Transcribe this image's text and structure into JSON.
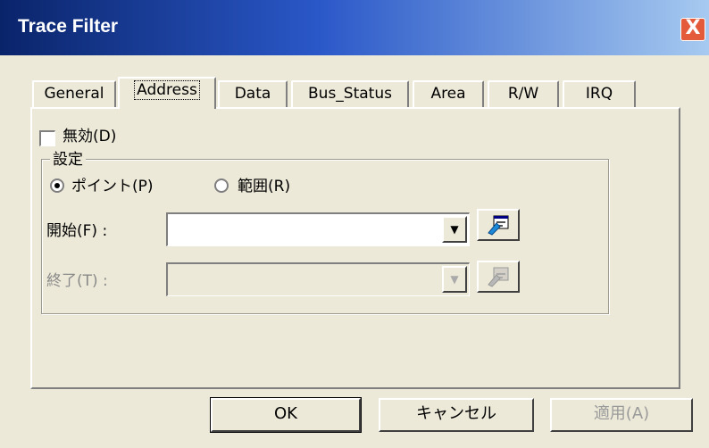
{
  "window": {
    "title": "Trace Filter",
    "close_label": "X"
  },
  "tabs": [
    {
      "label": "General",
      "active": false
    },
    {
      "label": "Address",
      "active": true
    },
    {
      "label": "Data",
      "active": false
    },
    {
      "label": "Bus_Status",
      "active": false
    },
    {
      "label": "Area",
      "active": false
    },
    {
      "label": "R/W",
      "active": false
    },
    {
      "label": "IRQ",
      "active": false
    }
  ],
  "disable_checkbox": {
    "label": "無効(D)",
    "checked": false
  },
  "settings_group": {
    "label": "設定",
    "radio_point": {
      "label": "ポイント(P)",
      "selected": true
    },
    "radio_range": {
      "label": "範囲(R)",
      "selected": false
    },
    "start": {
      "label": "開始(F) :",
      "value": "",
      "enabled": true
    },
    "end": {
      "label": "終了(T) :",
      "value": "",
      "enabled": false
    }
  },
  "buttons": {
    "ok": "OK",
    "cancel": "キャンセル",
    "apply": "適用(A)"
  },
  "colors": {
    "face": "#ECE9D8",
    "title_start": "#0A246A",
    "title_end": "#A6CAF0",
    "close": "#E35B3B"
  },
  "icons": {
    "dropdown": "triangle-down-icon",
    "picker": "symbol-picker-icon"
  }
}
